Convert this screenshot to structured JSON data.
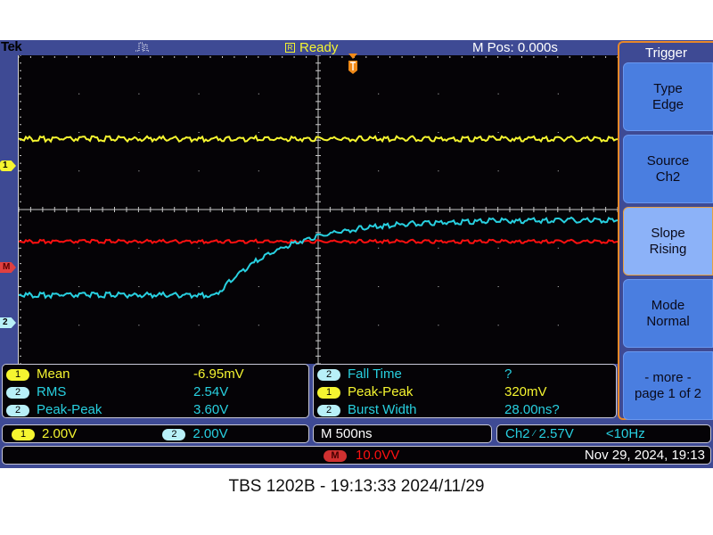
{
  "header": {
    "brand": "Tek",
    "acquisition_icon": "pulse-waveform-icon",
    "status_icon": "R",
    "status": "Ready",
    "m_pos": "M Pos: 0.000s"
  },
  "markers": {
    "ch1": "1",
    "math": "M",
    "ch2": "2"
  },
  "menu": {
    "title": "Trigger",
    "buttons": [
      {
        "line1": "Type",
        "line2": "Edge",
        "selected": false
      },
      {
        "line1": "Source",
        "line2": "Ch2",
        "selected": false
      },
      {
        "line1": "Slope",
        "line2": "Rising",
        "selected": true
      },
      {
        "line1": "Mode",
        "line2": "Normal",
        "selected": false
      },
      {
        "line1": "- more -",
        "line2": "page 1 of 2",
        "selected": false
      }
    ]
  },
  "measurements": {
    "left": [
      {
        "channel": "1",
        "label": "Mean",
        "value": "-6.95mV"
      },
      {
        "channel": "2",
        "label": "RMS",
        "value": "2.54V"
      },
      {
        "channel": "2",
        "label": "Peak-Peak",
        "value": "3.60V"
      }
    ],
    "right": [
      {
        "channel": "2",
        "label": "Fall Time",
        "value": "?"
      },
      {
        "channel": "1",
        "label": "Peak-Peak",
        "value": "320mV"
      },
      {
        "channel": "2",
        "label": "Burst Width",
        "value": "28.00ns?"
      }
    ]
  },
  "status": {
    "ch1_badge": "1",
    "ch1_scale": "2.00V",
    "ch2_badge": "2",
    "ch2_scale": "2.00V",
    "timebase": "M 500ns",
    "trigger_source": "Ch2",
    "trigger_slope_icon": "rising-edge-icon",
    "trigger_level": "2.57V",
    "trigger_freq": "<10Hz",
    "math_badge": "M",
    "math_scale": "10.0VV",
    "datetime": "Nov 29, 2024, 19:13"
  },
  "caption": "TBS 1202B - 19:13:33   2024/11/29",
  "colors": {
    "ch1": "#f5f530",
    "ch2": "#28d0e0",
    "math": "#ff1010",
    "trigger": "#f08a18",
    "frame": "#3e4a94"
  },
  "waveforms": {
    "ch1_level_div": 1.8,
    "math_level_div": -0.85,
    "ch2_start_div": -2.25,
    "ch2_rise_start_time_div": -1.7,
    "ch2_final_div": -0.3
  }
}
